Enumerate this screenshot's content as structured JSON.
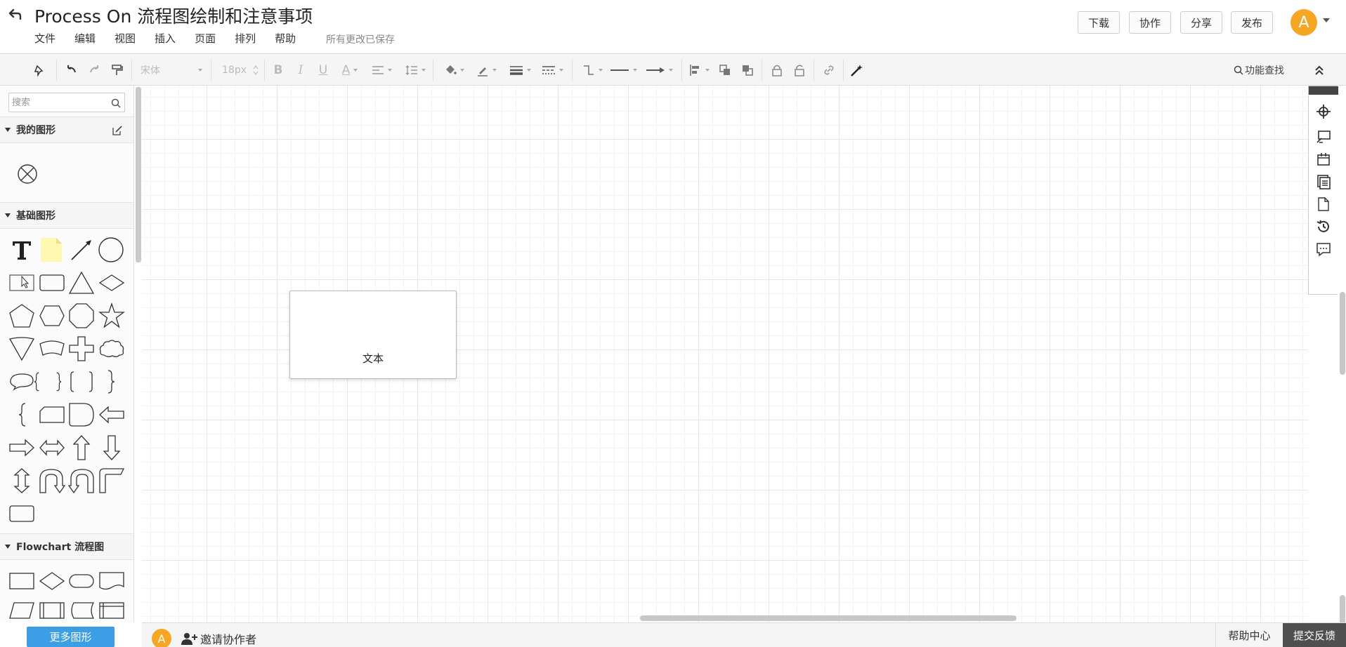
{
  "header": {
    "title": "Process On 流程图绘制和注意事项",
    "save_status": "所有更改已保存",
    "menu": [
      "文件",
      "编辑",
      "视图",
      "插入",
      "页面",
      "排列",
      "帮助"
    ],
    "buttons": {
      "download": "下载",
      "collaborate": "协作",
      "share": "分享",
      "publish": "发布"
    },
    "avatar_letter": "A"
  },
  "toolbar": {
    "font_family": "宋体",
    "font_size": "18px",
    "bold": "B",
    "italic": "I",
    "underline": "U",
    "font_color": "A",
    "feature_search": "功能查找"
  },
  "sidebar": {
    "search_placeholder": "搜索",
    "sections": {
      "my_shapes": "我的图形",
      "basic_shapes": "基础图形",
      "flowchart": "Flowchart 流程图"
    },
    "more_shapes": "更多图形"
  },
  "canvas": {
    "shape_text": "文本"
  },
  "footer": {
    "avatar_letter": "A",
    "invite": "邀请协作者",
    "help_center": "帮助中心",
    "feedback": "提交反馈"
  },
  "colors": {
    "accent": "#3c9ee5",
    "avatar": "#f5a623",
    "feedback_bg": "#4f4f4f"
  }
}
